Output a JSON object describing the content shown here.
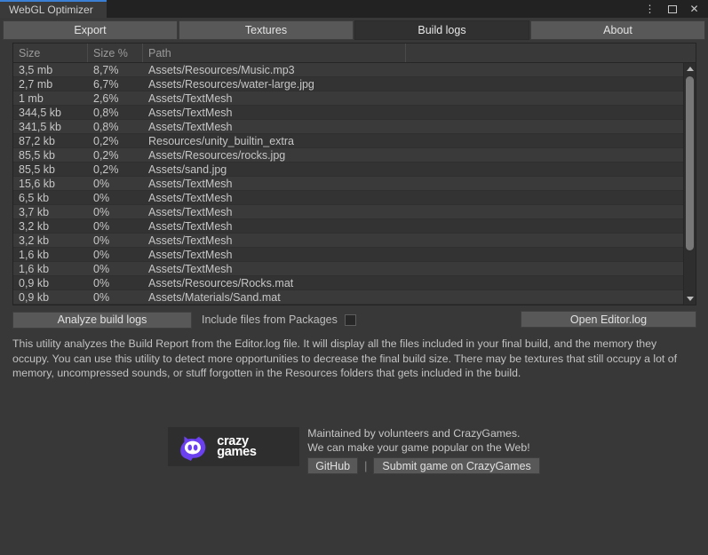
{
  "window": {
    "title": "WebGL Optimizer",
    "controls": [
      {
        "name": "menu-kebab-icon",
        "glyph": "⋮"
      },
      {
        "name": "maximize-icon",
        "glyph": ""
      },
      {
        "name": "close-icon",
        "glyph": "✕"
      }
    ],
    "accent_color": "#3b7fd4"
  },
  "tabs": [
    {
      "label": "Export",
      "active": false
    },
    {
      "label": "Textures",
      "active": false
    },
    {
      "label": "Build logs",
      "active": true
    },
    {
      "label": "About",
      "active": false
    }
  ],
  "table": {
    "columns": [
      "Size",
      "Size %",
      "Path"
    ],
    "rows": [
      {
        "size": "3,5 mb",
        "percent": "8,7%",
        "path": "Assets/Resources/Music.mp3"
      },
      {
        "size": "2,7 mb",
        "percent": "6,7%",
        "path": "Assets/Resources/water-large.jpg"
      },
      {
        "size": "1 mb",
        "percent": "2,6%",
        "path": "Assets/TextMesh"
      },
      {
        "size": "344,5 kb",
        "percent": "0,8%",
        "path": "Assets/TextMesh"
      },
      {
        "size": "341,5 kb",
        "percent": "0,8%",
        "path": "Assets/TextMesh"
      },
      {
        "size": "87,2 kb",
        "percent": "0,2%",
        "path": "Resources/unity_builtin_extra"
      },
      {
        "size": "85,5 kb",
        "percent": "0,2%",
        "path": "Assets/Resources/rocks.jpg"
      },
      {
        "size": "85,5 kb",
        "percent": "0,2%",
        "path": "Assets/sand.jpg"
      },
      {
        "size": "15,6 kb",
        "percent": "0%",
        "path": "Assets/TextMesh"
      },
      {
        "size": "6,5 kb",
        "percent": "0%",
        "path": "Assets/TextMesh"
      },
      {
        "size": "3,7 kb",
        "percent": "0%",
        "path": "Assets/TextMesh"
      },
      {
        "size": "3,2 kb",
        "percent": "0%",
        "path": "Assets/TextMesh"
      },
      {
        "size": "3,2 kb",
        "percent": "0%",
        "path": "Assets/TextMesh"
      },
      {
        "size": "1,6 kb",
        "percent": "0%",
        "path": "Assets/TextMesh"
      },
      {
        "size": "1,6 kb",
        "percent": "0%",
        "path": "Assets/TextMesh"
      },
      {
        "size": "0,9 kb",
        "percent": "0%",
        "path": "Assets/Resources/Rocks.mat"
      },
      {
        "size": "0,9 kb",
        "percent": "0%",
        "path": "Assets/Materials/Sand.mat"
      }
    ]
  },
  "toolbar": {
    "analyze_label": "Analyze build logs",
    "include_packages_label": "Include files from Packages",
    "include_packages_checked": false,
    "open_editor_log_label": "Open Editor.log"
  },
  "description": "This utility analyzes the Build Report from the Editor.log file. It will display all the files included in your final build, and the memory they occupy. You can use this utility to detect more opportunities to decrease the final build size. There may be textures that still occupy a lot of memory, uncompressed sounds, or stuff forgotten in the Resources folders that gets included in the build.",
  "footer": {
    "logo": {
      "line1": "crazy",
      "line2": "games",
      "color": "#6b41ef"
    },
    "line1": "Maintained by volunteers and CrazyGames.",
    "line2": "We can make your game popular on the Web!",
    "github_label": "GitHub",
    "separator": "|",
    "submit_label": "Submit game on CrazyGames"
  }
}
